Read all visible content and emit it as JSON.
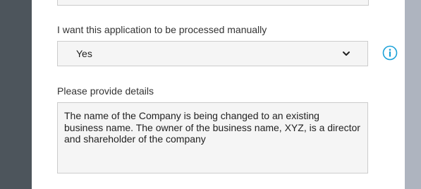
{
  "form": {
    "manual_processing": {
      "label": "I want this application to be processed manually",
      "selected_value": "Yes",
      "dropdown_icon": "chevron-down-icon",
      "info_icon": "info-circle-icon"
    },
    "details": {
      "label": "Please provide details",
      "value": "The name of the Company is being changed to an existing business name. The owner of the business name, XYZ, is a director and shareholder of the company"
    }
  },
  "colors": {
    "left_gutter": "#4d555c",
    "right_gutter": "#aeb4bf",
    "field_background": "#f5f5f5",
    "field_border": "#cccccc",
    "info_icon": "#1aa1d8"
  }
}
